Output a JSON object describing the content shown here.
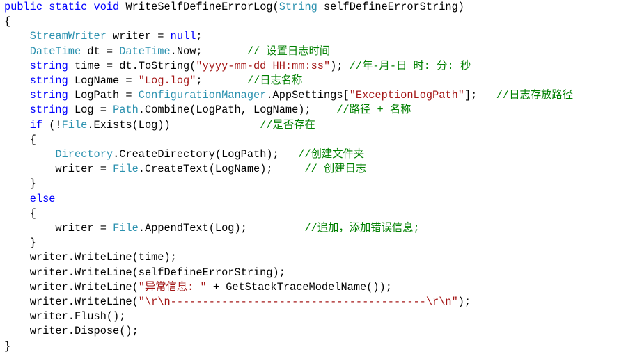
{
  "colors": {
    "background": "#ffffff",
    "keyword": "#0000ff",
    "type": "#2b91af",
    "string": "#a31515",
    "comment": "#008000",
    "text": "#000000"
  },
  "code_lines": [
    [
      [
        "kw",
        "public static void "
      ],
      [
        "txt",
        "WriteSelfDefineErrorLog("
      ],
      [
        "typ",
        "String"
      ],
      [
        "txt",
        " selfDefineErrorString)"
      ]
    ],
    [
      [
        "txt",
        "{"
      ]
    ],
    [
      [
        "txt",
        "    "
      ],
      [
        "typ",
        "StreamWriter"
      ],
      [
        "txt",
        " writer = "
      ],
      [
        "kw",
        "null"
      ],
      [
        "txt",
        ";"
      ]
    ],
    [
      [
        "txt",
        "    "
      ],
      [
        "typ",
        "DateTime"
      ],
      [
        "txt",
        " dt = "
      ],
      [
        "typ",
        "DateTime"
      ],
      [
        "txt",
        ".Now;       "
      ],
      [
        "cmt",
        "// 设置日志时间"
      ]
    ],
    [
      [
        "txt",
        "    "
      ],
      [
        "kw",
        "string"
      ],
      [
        "txt",
        " time = dt.ToString("
      ],
      [
        "str",
        "\"yyyy-mm-dd HH:mm:ss\""
      ],
      [
        "txt",
        "); "
      ],
      [
        "cmt",
        "//年-月-日 时: 分: 秒"
      ]
    ],
    [
      [
        "txt",
        "    "
      ],
      [
        "kw",
        "string"
      ],
      [
        "txt",
        " LogName = "
      ],
      [
        "str",
        "\"Log.log\""
      ],
      [
        "txt",
        ";       "
      ],
      [
        "cmt",
        "//日志名称"
      ]
    ],
    [
      [
        "txt",
        "    "
      ],
      [
        "kw",
        "string"
      ],
      [
        "txt",
        " LogPath = "
      ],
      [
        "typ",
        "ConfigurationManager"
      ],
      [
        "txt",
        ".AppSettings["
      ],
      [
        "str",
        "\"ExceptionLogPath\""
      ],
      [
        "txt",
        "];   "
      ],
      [
        "cmt",
        "//日志存放路径"
      ]
    ],
    [
      [
        "txt",
        "    "
      ],
      [
        "kw",
        "string"
      ],
      [
        "txt",
        " Log = "
      ],
      [
        "typ",
        "Path"
      ],
      [
        "txt",
        ".Combine(LogPath, LogName);    "
      ],
      [
        "cmt",
        "//路径 + 名称"
      ]
    ],
    [
      [
        "txt",
        "    "
      ],
      [
        "kw",
        "if"
      ],
      [
        "txt",
        " (!"
      ],
      [
        "typ",
        "File"
      ],
      [
        "txt",
        ".Exists(Log))              "
      ],
      [
        "cmt",
        "//是否存在"
      ]
    ],
    [
      [
        "txt",
        "    {"
      ]
    ],
    [
      [
        "txt",
        "        "
      ],
      [
        "typ",
        "Directory"
      ],
      [
        "txt",
        ".CreateDirectory(LogPath);   "
      ],
      [
        "cmt",
        "//创建文件夹"
      ]
    ],
    [
      [
        "txt",
        "        writer = "
      ],
      [
        "typ",
        "File"
      ],
      [
        "txt",
        ".CreateText(LogName);     "
      ],
      [
        "cmt",
        "// 创建日志"
      ]
    ],
    [
      [
        "txt",
        "    }"
      ]
    ],
    [
      [
        "txt",
        "    "
      ],
      [
        "kw",
        "else"
      ]
    ],
    [
      [
        "txt",
        "    {"
      ]
    ],
    [
      [
        "txt",
        "        writer = "
      ],
      [
        "typ",
        "File"
      ],
      [
        "txt",
        ".AppendText(Log);         "
      ],
      [
        "cmt",
        "//追加，添加错误信息;"
      ]
    ],
    [
      [
        "txt",
        "    }"
      ]
    ],
    [
      [
        "txt",
        "    writer.WriteLine(time);"
      ]
    ],
    [
      [
        "txt",
        "    writer.WriteLine(selfDefineErrorString);"
      ]
    ],
    [
      [
        "txt",
        "    writer.WriteLine("
      ],
      [
        "str",
        "\"异常信息: \""
      ],
      [
        "txt",
        " + GetStackTraceModelName());"
      ]
    ],
    [
      [
        "txt",
        "    writer.WriteLine("
      ],
      [
        "str",
        "\"\\r\\n----------------------------------------\\r\\n\""
      ],
      [
        "txt",
        ");"
      ]
    ],
    [
      [
        "txt",
        "    writer.Flush();"
      ]
    ],
    [
      [
        "txt",
        "    writer.Dispose();"
      ]
    ],
    [
      [
        "txt",
        "}"
      ]
    ]
  ]
}
